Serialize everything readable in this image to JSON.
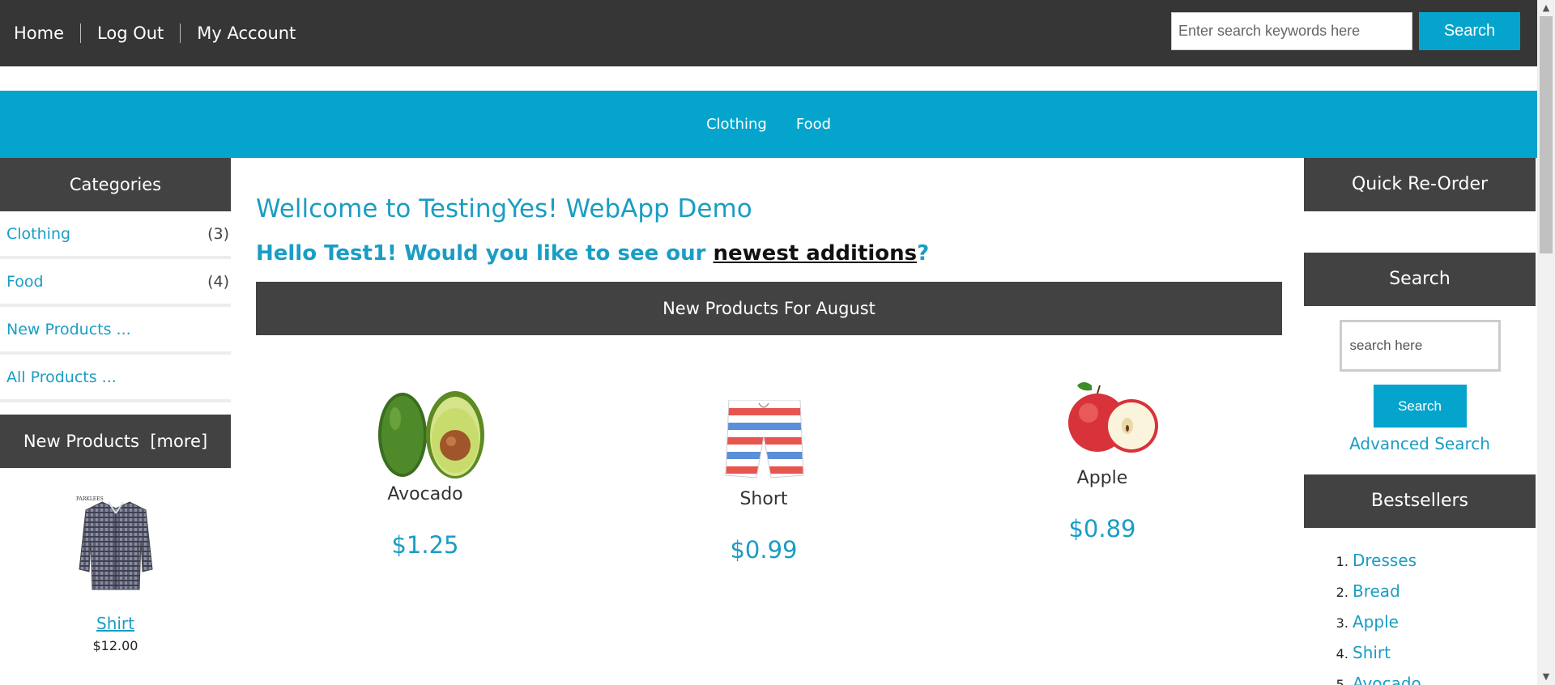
{
  "topnav": {
    "items": [
      "Home",
      "Log Out",
      "My Account"
    ],
    "search_placeholder": "Enter search keywords here",
    "search_button": "Search"
  },
  "category_bar": {
    "items": [
      "Clothing",
      "Food"
    ]
  },
  "left": {
    "categories_title": "Categories",
    "categories": [
      {
        "label": "Clothing",
        "count": "(3)"
      },
      {
        "label": "Food",
        "count": "(4)"
      },
      {
        "label": "New Products ...",
        "count": ""
      },
      {
        "label": "All Products ...",
        "count": ""
      }
    ],
    "new_products_title": "New Products  [more]",
    "new_product": {
      "name": "Shirt",
      "price": "$12.00",
      "brand_mark": "PARKLEES"
    }
  },
  "main": {
    "welcome": "Wellcome to TestingYes! WebApp Demo",
    "hello_prefix": "Hello Test1! Would you like to see our ",
    "hello_link": "newest additions",
    "hello_suffix": "?",
    "section_title": "New Products For August",
    "products": [
      {
        "name": "Avocado",
        "price": "$1.25",
        "icon": "avocado-image"
      },
      {
        "name": "Short",
        "price": "$0.99",
        "icon": "shorts-image"
      },
      {
        "name": "Apple",
        "price": "$0.89",
        "icon": "apple-image"
      }
    ]
  },
  "right": {
    "quick_reorder_title": "Quick Re-Order",
    "search_title": "Search",
    "search_placeholder": "search here",
    "search_button": "Search",
    "advanced_search": "Advanced Search",
    "bestsellers_title": "Bestsellers",
    "bestsellers": [
      "Dresses",
      "Bread",
      "Apple",
      "Shirt",
      "Avocado"
    ]
  },
  "colors": {
    "accent": "#05a4cc",
    "topbar": "#363636",
    "panel_header": "#424242"
  }
}
